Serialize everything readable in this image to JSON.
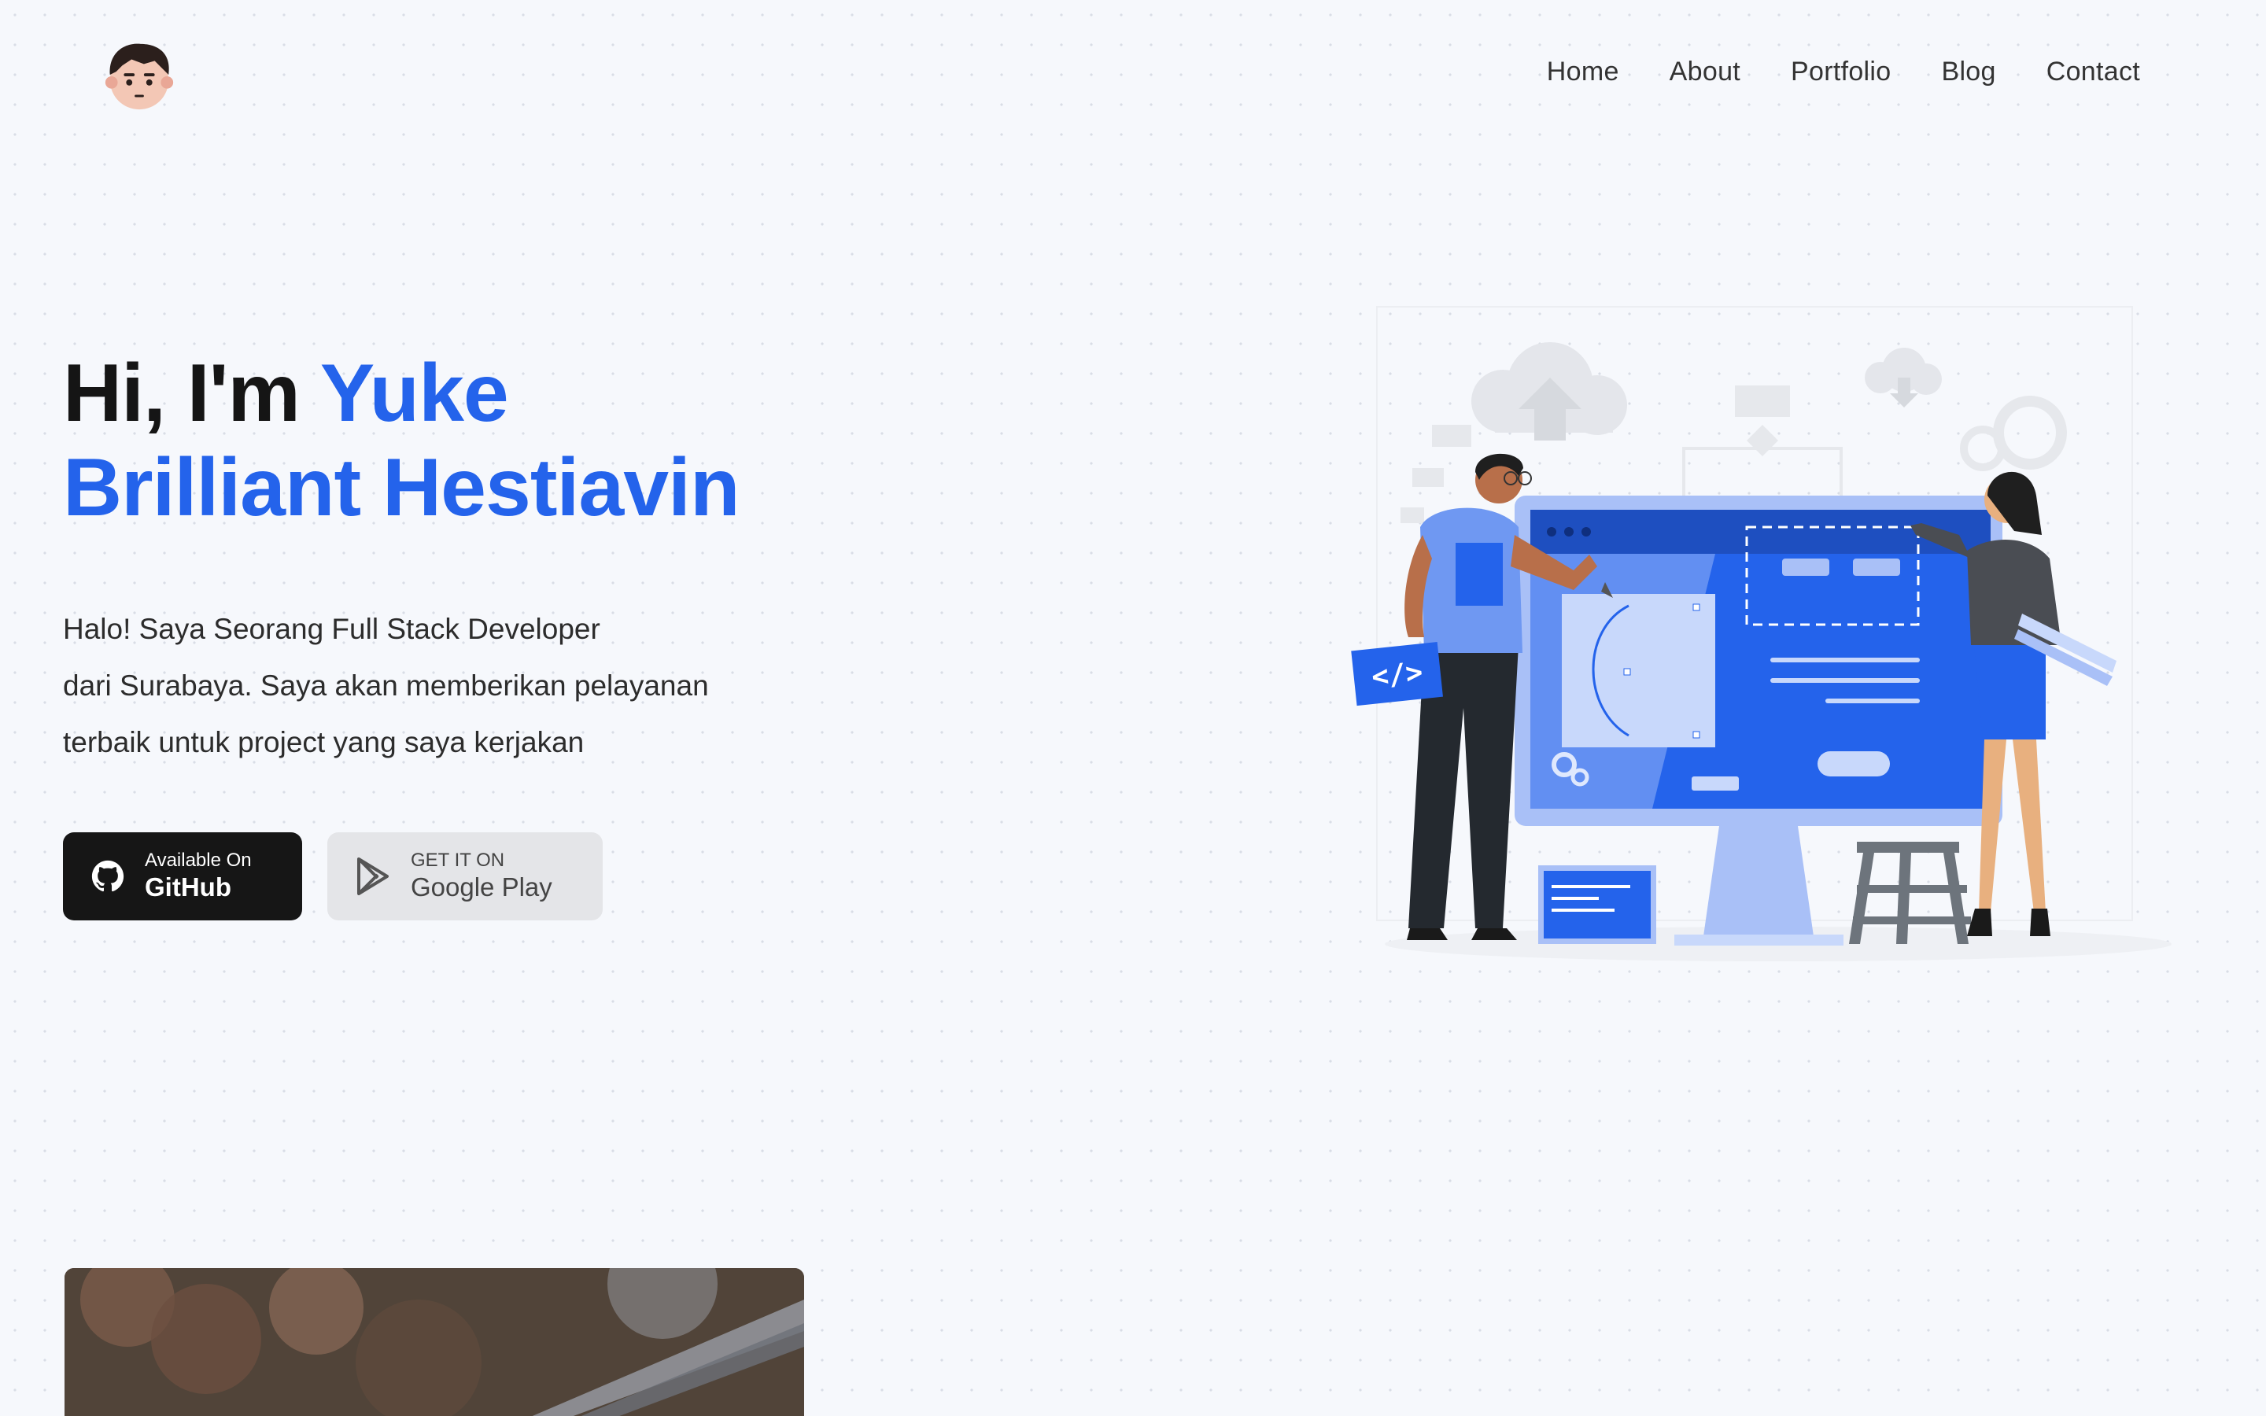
{
  "nav": {
    "items": [
      {
        "label": "Home"
      },
      {
        "label": "About"
      },
      {
        "label": "Portfolio"
      },
      {
        "label": "Blog"
      },
      {
        "label": "Contact"
      }
    ]
  },
  "hero": {
    "greeting": "Hi, I'm",
    "name_part1": "Yuke",
    "name_part2": "Brilliant Hestiavin",
    "description_lines": [
      "Halo! Saya Seorang Full Stack Developer",
      "dari Surabaya. Saya akan memberikan pelayanan",
      "terbaik untuk project yang saya kerjakan"
    ]
  },
  "buttons": {
    "github": {
      "small": "Available On",
      "big": "GitHub",
      "icon": "github-icon"
    },
    "play": {
      "small": "GET IT ON",
      "big": "Google Play",
      "icon": "play-store-icon"
    }
  },
  "colors": {
    "accent": "#2463eb",
    "background": "#f6f8fc",
    "dark_button": "#161616",
    "light_button": "#e4e5e8"
  }
}
